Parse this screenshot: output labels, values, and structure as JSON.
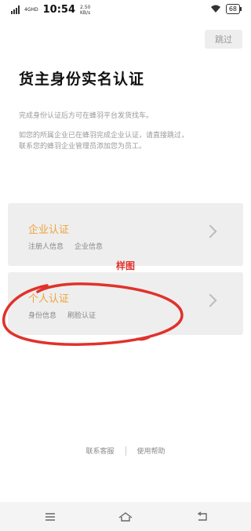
{
  "status": {
    "network": "4GHD",
    "time": "10:54",
    "speed_value": "2.50",
    "speed_unit": "KB/s",
    "battery": "68"
  },
  "header": {
    "skip_label": "跳过",
    "title": "货主身份实名认证"
  },
  "description": {
    "line1": "完成身份认证后方可在蜂羽平台发货找车。",
    "line2": "如您的所属企业已在蜂羽完成企业认证，请直接跳过，",
    "line3": "联系您的蜂羽企业管理员添加您为员工。"
  },
  "cards": {
    "company": {
      "title": "企业认证",
      "items": [
        "注册人信息",
        "企业信息"
      ]
    },
    "personal": {
      "title": "个人认证",
      "items": [
        "身份信息",
        "刷脸认证"
      ]
    }
  },
  "sample_label": "样图",
  "footer": {
    "contact": "联系客服",
    "help": "使用帮助"
  },
  "colors": {
    "accent": "#f0a23c",
    "annotation": "#e0322b"
  }
}
